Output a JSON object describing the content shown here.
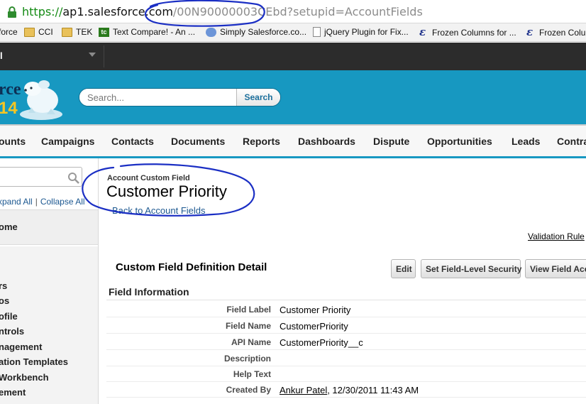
{
  "browser": {
    "url_scheme": "https://",
    "url_host": "ap1.salesforce.com",
    "url_path": "/00N90000003CEbd?setupid=AccountFields",
    "lock_icon": "lock-icon"
  },
  "bookmarks": [
    {
      "label": "force",
      "icon": "none"
    },
    {
      "label": "CCI",
      "icon": "folder-icon"
    },
    {
      "label": "TEK",
      "icon": "folder-icon"
    },
    {
      "label": "Text Compare! - An ...",
      "icon": "tc-icon"
    },
    {
      "label": "Simply Salesforce.co...",
      "icon": "cloud-icon"
    },
    {
      "label": "jQuery Plugin for Fix...",
      "icon": "page-icon"
    },
    {
      "label": "Frozen Columns for ...",
      "icon": "e-icon"
    },
    {
      "label": "Frozen Colu",
      "icon": "e-icon"
    }
  ],
  "appbar": {
    "name": "l"
  },
  "header": {
    "logo_text": "rce",
    "logo_year": "14",
    "search_placeholder": "Search...",
    "search_button": "Search"
  },
  "tabs": [
    "ounts",
    "Campaigns",
    "Contacts",
    "Documents",
    "Reports",
    "Dashboards",
    "Dispute",
    "Opportunities",
    "Leads",
    "Contra"
  ],
  "sidebar": {
    "expand_all": "xpand All",
    "collapse_all": "Collapse All",
    "home": "ome",
    "links": [
      "rs",
      "os",
      "ofile",
      "ntrols",
      "nagement",
      "ation Templates",
      "Workbench",
      "ement"
    ]
  },
  "page": {
    "type": "Account Custom Field",
    "title": "Customer Priority",
    "back_link": "Back to Account Fields",
    "validation_link": "Validation Rule"
  },
  "detail": {
    "title": "Custom Field Definition Detail",
    "buttons": {
      "edit": "Edit",
      "fls": "Set Field-Level Security",
      "view": "View Field Acc"
    },
    "section": "Field Information",
    "fields": [
      {
        "label": "Field Label",
        "value": "Customer Priority"
      },
      {
        "label": "Field Name",
        "value": "CustomerPriority"
      },
      {
        "label": "API Name",
        "value": "CustomerPriority__c"
      },
      {
        "label": "Description",
        "value": ""
      },
      {
        "label": "Help Text",
        "value": ""
      }
    ],
    "created_by": {
      "label": "Created By",
      "user": "Ankur Patel",
      "date": ", 12/30/2011 11:43 AM"
    }
  },
  "colors": {
    "header_blue": "#1798c1",
    "link_blue": "#1b5790",
    "annotation_blue": "#1b2fc4"
  }
}
